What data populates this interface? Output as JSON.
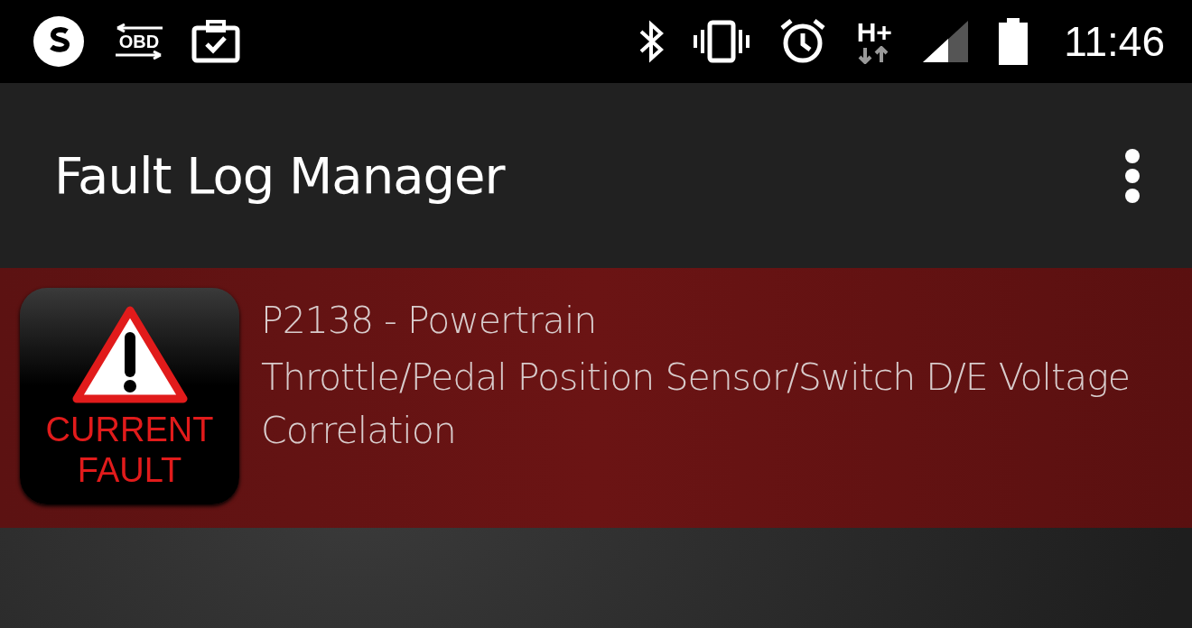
{
  "status_bar": {
    "obd_label": "OBD",
    "network": "H+",
    "time": "11:46"
  },
  "app_bar": {
    "title": "Fault Log Manager"
  },
  "faults": [
    {
      "kind": "current",
      "badge": "CURRENT FAULT",
      "code": "P2138 - Powertrain",
      "description": "Throttle/Pedal Position Sensor/Switch D/E Voltage Correlation"
    }
  ]
}
